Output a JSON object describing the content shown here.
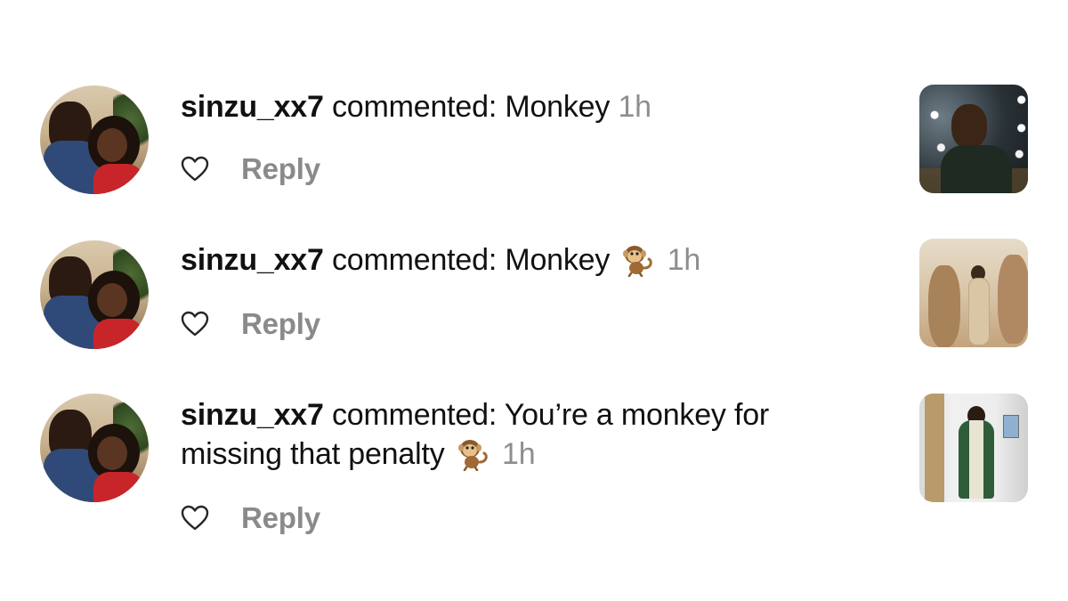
{
  "comments": [
    {
      "username": "sinzu_xx7",
      "action": "commented:",
      "text": "Monkey",
      "text_line2": "",
      "has_emoji": false,
      "time": "1h",
      "reply_label": "Reply"
    },
    {
      "username": "sinzu_xx7",
      "action": "commented:",
      "text": "Monkey",
      "text_line2": "",
      "has_emoji": true,
      "time": "1h",
      "reply_label": "Reply"
    },
    {
      "username": "sinzu_xx7",
      "action": "commented:",
      "text": "You’re a monkey for",
      "text_line2": "missing that penalty",
      "has_emoji": true,
      "time": "1h",
      "reply_label": "Reply"
    }
  ],
  "icons": {
    "like": "heart-outline-icon",
    "emoji": "monkey-emoji"
  },
  "colors": {
    "text": "#111111",
    "muted": "#8e8e8e",
    "reply": "#8a8a8a"
  }
}
